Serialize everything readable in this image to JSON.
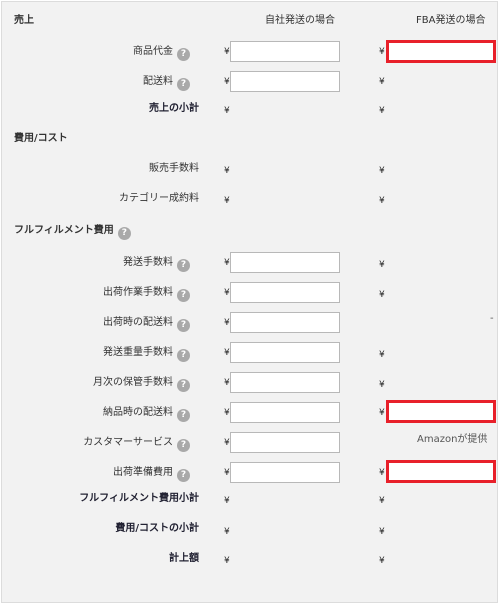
{
  "columns": {
    "self_ship": "自社発送の場合",
    "fba": "FBA発送の場合"
  },
  "currency_symbol": "¥",
  "help_glyph": "?",
  "sections": {
    "sales": "売上",
    "costs": "費用/コスト",
    "fulfillment": "フルフィルメント費用"
  },
  "rows": {
    "item_price": "商品代金",
    "shipping": "配送料",
    "sales_subtotal": "売上の小計",
    "selling_fee": "販売手数料",
    "category_fee": "カテゴリー成約料",
    "shipping_fee": "発送手数料",
    "pick_pack_fee": "出荷作業手数料",
    "outbound_shipping": "出荷時の配送料",
    "weight_handling_fee": "発送重量手数料",
    "monthly_storage_fee": "月次の保管手数料",
    "inbound_shipping": "納品時の配送料",
    "customer_service": "カスタマーサービス",
    "prep_cost": "出荷準備費用",
    "fulfillment_subtotal": "フルフィルメント費用小計",
    "cost_subtotal": "費用/コストの小計",
    "net": "計上額"
  },
  "fba_notes": {
    "outbound_shipping": "-",
    "customer_service": "Amazonが提供"
  },
  "colors": {
    "highlight": "#e8202a",
    "panel": "#f2f2f2"
  }
}
